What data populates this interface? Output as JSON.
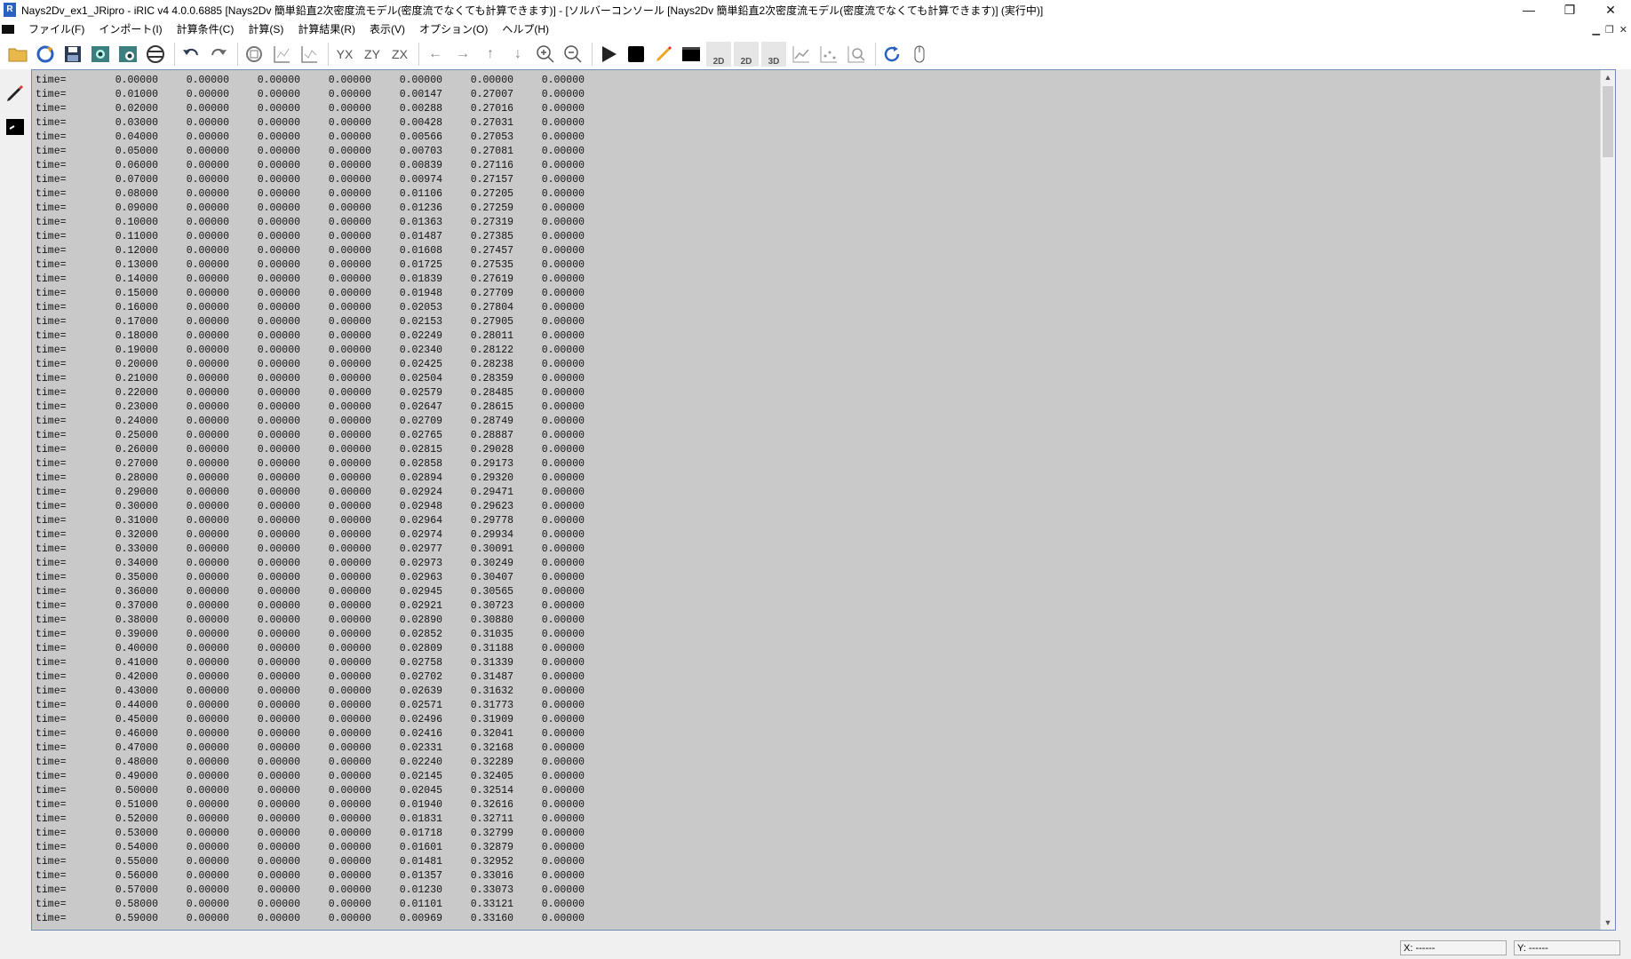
{
  "window": {
    "title": "Nays2Dv_ex1_JRipro - iRIC v4 4.0.0.6885 [Nays2Dv 簡単鉛直2次密度流モデル(密度流でなくても計算できます)] - [ソルバーコンソール [Nays2Dv 簡単鉛直2次密度流モデル(密度流でなくても計算できます)] (実行中)]",
    "controls": {
      "minimize": "—",
      "restore": "❐",
      "close": "✕"
    }
  },
  "menu": {
    "items": [
      "ファイル(F)",
      "インポート(I)",
      "計算条件(C)",
      "計算(S)",
      "計算結果(R)",
      "表示(V)",
      "オプション(O)",
      "ヘルプ(H)"
    ]
  },
  "toolbar": {
    "icons": [
      "open-folder-icon",
      "reload-icon",
      "save-icon",
      "camera-icon",
      "snapshot-icon",
      "no-entry-icon",
      "undo-icon",
      "redo-icon",
      "select-icon",
      "chart-x-icon",
      "chart-xy-icon",
      "axis-yx-icon",
      "axis-zy-icon",
      "axis-zx-icon",
      "arrow-left-icon",
      "arrow-right-icon",
      "arrow-up-icon",
      "arrow-down-icon",
      "zoom-in-icon",
      "zoom-out-icon",
      "run-icon",
      "stop-icon",
      "pencil-icon",
      "console-icon",
      "post-2d-icon",
      "post-2d-alt-icon",
      "post-3d-icon",
      "graph-icon",
      "scatter-icon",
      "zoom-fit-icon",
      "refresh-icon",
      "mouse-icon"
    ],
    "labels": {
      "yx": "YX",
      "zy": "ZY",
      "zx": "ZX",
      "p2d": "2D",
      "p2d2": "2D",
      "p3d": "3D"
    }
  },
  "console": {
    "rows": [
      [
        "time=",
        "0.00000",
        "0.00000",
        "0.00000",
        "0.00000",
        "0.00000",
        "0.00000",
        "0.00000"
      ],
      [
        "time=",
        "0.01000",
        "0.00000",
        "0.00000",
        "0.00000",
        "0.00147",
        "0.27007",
        "0.00000"
      ],
      [
        "time=",
        "0.02000",
        "0.00000",
        "0.00000",
        "0.00000",
        "0.00288",
        "0.27016",
        "0.00000"
      ],
      [
        "time=",
        "0.03000",
        "0.00000",
        "0.00000",
        "0.00000",
        "0.00428",
        "0.27031",
        "0.00000"
      ],
      [
        "time=",
        "0.04000",
        "0.00000",
        "0.00000",
        "0.00000",
        "0.00566",
        "0.27053",
        "0.00000"
      ],
      [
        "time=",
        "0.05000",
        "0.00000",
        "0.00000",
        "0.00000",
        "0.00703",
        "0.27081",
        "0.00000"
      ],
      [
        "time=",
        "0.06000",
        "0.00000",
        "0.00000",
        "0.00000",
        "0.00839",
        "0.27116",
        "0.00000"
      ],
      [
        "time=",
        "0.07000",
        "0.00000",
        "0.00000",
        "0.00000",
        "0.00974",
        "0.27157",
        "0.00000"
      ],
      [
        "time=",
        "0.08000",
        "0.00000",
        "0.00000",
        "0.00000",
        "0.01106",
        "0.27205",
        "0.00000"
      ],
      [
        "time=",
        "0.09000",
        "0.00000",
        "0.00000",
        "0.00000",
        "0.01236",
        "0.27259",
        "0.00000"
      ],
      [
        "time=",
        "0.10000",
        "0.00000",
        "0.00000",
        "0.00000",
        "0.01363",
        "0.27319",
        "0.00000"
      ],
      [
        "time=",
        "0.11000",
        "0.00000",
        "0.00000",
        "0.00000",
        "0.01487",
        "0.27385",
        "0.00000"
      ],
      [
        "time=",
        "0.12000",
        "0.00000",
        "0.00000",
        "0.00000",
        "0.01608",
        "0.27457",
        "0.00000"
      ],
      [
        "time=",
        "0.13000",
        "0.00000",
        "0.00000",
        "0.00000",
        "0.01725",
        "0.27535",
        "0.00000"
      ],
      [
        "time=",
        "0.14000",
        "0.00000",
        "0.00000",
        "0.00000",
        "0.01839",
        "0.27619",
        "0.00000"
      ],
      [
        "time=",
        "0.15000",
        "0.00000",
        "0.00000",
        "0.00000",
        "0.01948",
        "0.27709",
        "0.00000"
      ],
      [
        "time=",
        "0.16000",
        "0.00000",
        "0.00000",
        "0.00000",
        "0.02053",
        "0.27804",
        "0.00000"
      ],
      [
        "time=",
        "0.17000",
        "0.00000",
        "0.00000",
        "0.00000",
        "0.02153",
        "0.27905",
        "0.00000"
      ],
      [
        "time=",
        "0.18000",
        "0.00000",
        "0.00000",
        "0.00000",
        "0.02249",
        "0.28011",
        "0.00000"
      ],
      [
        "time=",
        "0.19000",
        "0.00000",
        "0.00000",
        "0.00000",
        "0.02340",
        "0.28122",
        "0.00000"
      ],
      [
        "time=",
        "0.20000",
        "0.00000",
        "0.00000",
        "0.00000",
        "0.02425",
        "0.28238",
        "0.00000"
      ],
      [
        "time=",
        "0.21000",
        "0.00000",
        "0.00000",
        "0.00000",
        "0.02504",
        "0.28359",
        "0.00000"
      ],
      [
        "time=",
        "0.22000",
        "0.00000",
        "0.00000",
        "0.00000",
        "0.02579",
        "0.28485",
        "0.00000"
      ],
      [
        "time=",
        "0.23000",
        "0.00000",
        "0.00000",
        "0.00000",
        "0.02647",
        "0.28615",
        "0.00000"
      ],
      [
        "time=",
        "0.24000",
        "0.00000",
        "0.00000",
        "0.00000",
        "0.02709",
        "0.28749",
        "0.00000"
      ],
      [
        "time=",
        "0.25000",
        "0.00000",
        "0.00000",
        "0.00000",
        "0.02765",
        "0.28887",
        "0.00000"
      ],
      [
        "time=",
        "0.26000",
        "0.00000",
        "0.00000",
        "0.00000",
        "0.02815",
        "0.29028",
        "0.00000"
      ],
      [
        "time=",
        "0.27000",
        "0.00000",
        "0.00000",
        "0.00000",
        "0.02858",
        "0.29173",
        "0.00000"
      ],
      [
        "time=",
        "0.28000",
        "0.00000",
        "0.00000",
        "0.00000",
        "0.02894",
        "0.29320",
        "0.00000"
      ],
      [
        "time=",
        "0.29000",
        "0.00000",
        "0.00000",
        "0.00000",
        "0.02924",
        "0.29471",
        "0.00000"
      ],
      [
        "time=",
        "0.30000",
        "0.00000",
        "0.00000",
        "0.00000",
        "0.02948",
        "0.29623",
        "0.00000"
      ],
      [
        "time=",
        "0.31000",
        "0.00000",
        "0.00000",
        "0.00000",
        "0.02964",
        "0.29778",
        "0.00000"
      ],
      [
        "time=",
        "0.32000",
        "0.00000",
        "0.00000",
        "0.00000",
        "0.02974",
        "0.29934",
        "0.00000"
      ],
      [
        "time=",
        "0.33000",
        "0.00000",
        "0.00000",
        "0.00000",
        "0.02977",
        "0.30091",
        "0.00000"
      ],
      [
        "time=",
        "0.34000",
        "0.00000",
        "0.00000",
        "0.00000",
        "0.02973",
        "0.30249",
        "0.00000"
      ],
      [
        "time=",
        "0.35000",
        "0.00000",
        "0.00000",
        "0.00000",
        "0.02963",
        "0.30407",
        "0.00000"
      ],
      [
        "time=",
        "0.36000",
        "0.00000",
        "0.00000",
        "0.00000",
        "0.02945",
        "0.30565",
        "0.00000"
      ],
      [
        "time=",
        "0.37000",
        "0.00000",
        "0.00000",
        "0.00000",
        "0.02921",
        "0.30723",
        "0.00000"
      ],
      [
        "time=",
        "0.38000",
        "0.00000",
        "0.00000",
        "0.00000",
        "0.02890",
        "0.30880",
        "0.00000"
      ],
      [
        "time=",
        "0.39000",
        "0.00000",
        "0.00000",
        "0.00000",
        "0.02852",
        "0.31035",
        "0.00000"
      ],
      [
        "time=",
        "0.40000",
        "0.00000",
        "0.00000",
        "0.00000",
        "0.02809",
        "0.31188",
        "0.00000"
      ],
      [
        "time=",
        "0.41000",
        "0.00000",
        "0.00000",
        "0.00000",
        "0.02758",
        "0.31339",
        "0.00000"
      ],
      [
        "time=",
        "0.42000",
        "0.00000",
        "0.00000",
        "0.00000",
        "0.02702",
        "0.31487",
        "0.00000"
      ],
      [
        "time=",
        "0.43000",
        "0.00000",
        "0.00000",
        "0.00000",
        "0.02639",
        "0.31632",
        "0.00000"
      ],
      [
        "time=",
        "0.44000",
        "0.00000",
        "0.00000",
        "0.00000",
        "0.02571",
        "0.31773",
        "0.00000"
      ],
      [
        "time=",
        "0.45000",
        "0.00000",
        "0.00000",
        "0.00000",
        "0.02496",
        "0.31909",
        "0.00000"
      ],
      [
        "time=",
        "0.46000",
        "0.00000",
        "0.00000",
        "0.00000",
        "0.02416",
        "0.32041",
        "0.00000"
      ],
      [
        "time=",
        "0.47000",
        "0.00000",
        "0.00000",
        "0.00000",
        "0.02331",
        "0.32168",
        "0.00000"
      ],
      [
        "time=",
        "0.48000",
        "0.00000",
        "0.00000",
        "0.00000",
        "0.02240",
        "0.32289",
        "0.00000"
      ],
      [
        "time=",
        "0.49000",
        "0.00000",
        "0.00000",
        "0.00000",
        "0.02145",
        "0.32405",
        "0.00000"
      ],
      [
        "time=",
        "0.50000",
        "0.00000",
        "0.00000",
        "0.00000",
        "0.02045",
        "0.32514",
        "0.00000"
      ],
      [
        "time=",
        "0.51000",
        "0.00000",
        "0.00000",
        "0.00000",
        "0.01940",
        "0.32616",
        "0.00000"
      ],
      [
        "time=",
        "0.52000",
        "0.00000",
        "0.00000",
        "0.00000",
        "0.01831",
        "0.32711",
        "0.00000"
      ],
      [
        "time=",
        "0.53000",
        "0.00000",
        "0.00000",
        "0.00000",
        "0.01718",
        "0.32799",
        "0.00000"
      ],
      [
        "time=",
        "0.54000",
        "0.00000",
        "0.00000",
        "0.00000",
        "0.01601",
        "0.32879",
        "0.00000"
      ],
      [
        "time=",
        "0.55000",
        "0.00000",
        "0.00000",
        "0.00000",
        "0.01481",
        "0.32952",
        "0.00000"
      ],
      [
        "time=",
        "0.56000",
        "0.00000",
        "0.00000",
        "0.00000",
        "0.01357",
        "0.33016",
        "0.00000"
      ],
      [
        "time=",
        "0.57000",
        "0.00000",
        "0.00000",
        "0.00000",
        "0.01230",
        "0.33073",
        "0.00000"
      ],
      [
        "time=",
        "0.58000",
        "0.00000",
        "0.00000",
        "0.00000",
        "0.01101",
        "0.33121",
        "0.00000"
      ],
      [
        "time=",
        "0.59000",
        "0.00000",
        "0.00000",
        "0.00000",
        "0.00969",
        "0.33160",
        "0.00000"
      ]
    ]
  },
  "status": {
    "x": "X: ------",
    "y": "Y: ------"
  },
  "colors": {
    "console_bg": "#c9c9c9",
    "accent": "#2a62c2"
  }
}
